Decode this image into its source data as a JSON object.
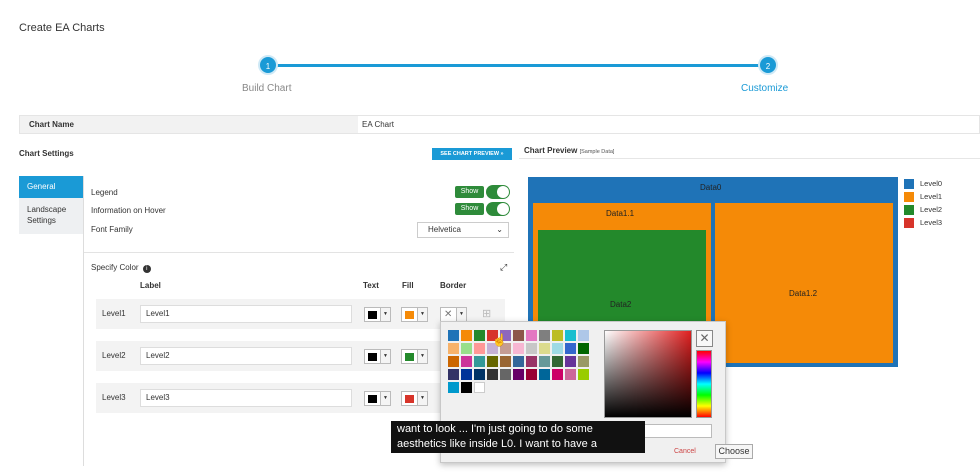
{
  "page": {
    "title": "Create EA Charts"
  },
  "stepper": {
    "steps": [
      {
        "number": "1",
        "label": "Build Chart"
      },
      {
        "number": "2",
        "label": "Customize"
      }
    ]
  },
  "chart_name": {
    "label": "Chart Name",
    "value": "EA Chart"
  },
  "settings": {
    "title": "Chart Settings",
    "preview_button": "SEE CHART PREVIEW »",
    "tabs": [
      {
        "label": "General",
        "active": true
      },
      {
        "label": "Landscape Settings",
        "active": false
      }
    ],
    "legend_label": "Legend",
    "legend_toggle": "Show",
    "hover_label": "Information on Hover",
    "hover_toggle": "Show",
    "font_family_label": "Font Family",
    "font_family_value": "Helvetica",
    "specify_color_label": "Specify Color",
    "columns": {
      "label": "Label",
      "text": "Text",
      "fill": "Fill",
      "border": "Border"
    },
    "levels": [
      {
        "name": "Level1",
        "label": "Level1",
        "text_color": "#000000",
        "fill_color": "#f58a07"
      },
      {
        "name": "Level2",
        "label": "Level2",
        "text_color": "#000000",
        "fill_color": "#23892b"
      },
      {
        "name": "Level3",
        "label": "Level3",
        "text_color": "#000000",
        "fill_color": "#d7342a"
      }
    ]
  },
  "palette": {
    "cancel_label": "Cancel",
    "choose_label": "Choose",
    "colors": [
      "#1f73b7",
      "#f58a07",
      "#23892b",
      "#d7342a",
      "#8e67bd",
      "#8c564b",
      "#e377c2",
      "#7f7f7f",
      "#bcbd22",
      "#17becf",
      "#aec7e8",
      "#f7b26a",
      "#98df8a",
      "#ff9896",
      "#c5b0d5",
      "#c49c94",
      "#f7b6d2",
      "#c7c7c7",
      "#dbdb8d",
      "#9edae5",
      "#3366cc",
      "#006600",
      "#cc6600",
      "#cc3399",
      "#339999",
      "#666600",
      "#996633",
      "#336699",
      "#993366",
      "#669999",
      "#336633",
      "#663399",
      "#999966",
      "#333366",
      "#003399",
      "#003366",
      "#333333",
      "#666666",
      "#660066",
      "#990033",
      "#006699",
      "#cc0066",
      "#cc6699",
      "#99cc00",
      "#0099cc",
      "#000000",
      "#ffffff"
    ]
  },
  "caption": "want to look ... I'm just going to do some aesthetics like inside L0. I want to have a",
  "preview": {
    "title": "Chart Preview",
    "subtitle": "[Sample Data]"
  },
  "treemap": {
    "root": {
      "label": "Data0",
      "color": "#1f73b7"
    },
    "children": [
      {
        "label": "Data1.1",
        "color": "#f58a07",
        "children": [
          {
            "label": "Data2",
            "color": "#23892b"
          }
        ]
      },
      {
        "label": "Data1.2",
        "color": "#f58a07"
      }
    ]
  },
  "legend": [
    {
      "label": "Level0",
      "color": "#1f73b7"
    },
    {
      "label": "Level1",
      "color": "#f58a07"
    },
    {
      "label": "Level2",
      "color": "#23892b"
    },
    {
      "label": "Level3",
      "color": "#d7342a"
    }
  ]
}
